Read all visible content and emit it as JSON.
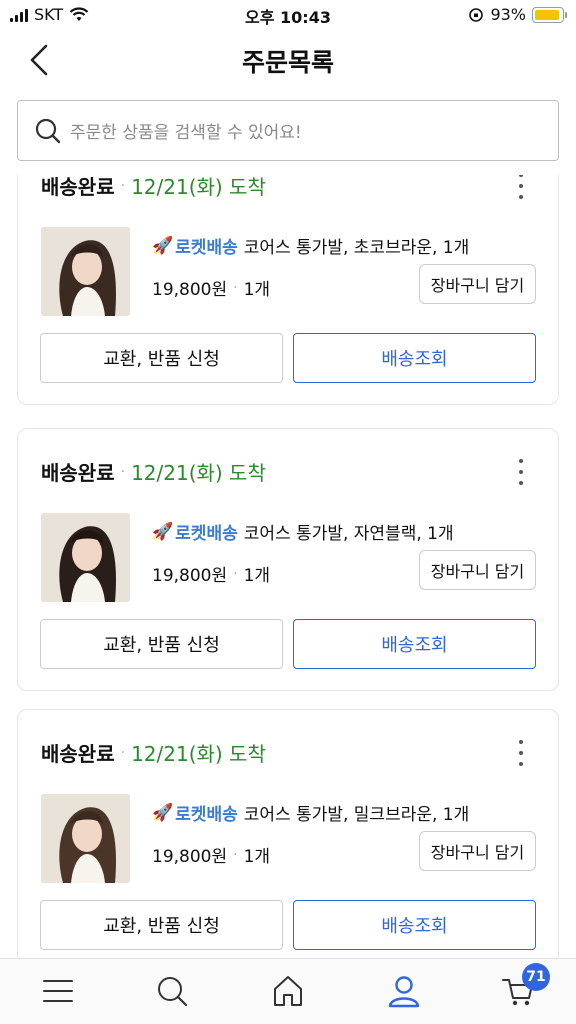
{
  "status_bar": {
    "carrier": "SKT",
    "time": "오후 10:43",
    "battery": "93%",
    "battery_level": 0.93,
    "battery_color": "#f5c400"
  },
  "header": {
    "title": "주문목록",
    "back_icon": "chevron-left-icon"
  },
  "search": {
    "placeholder": "주문한 상품을 검색할 수 있어요!",
    "icon": "search-icon"
  },
  "orders": [
    {
      "status": "배송완료",
      "arrival": "12/21(화) 도착",
      "rocket_label": "로켓배송",
      "product": "코어스 통가발, 초코브라운, 1개",
      "price": "19,800원",
      "quantity": "1개",
      "cart_button": "장바구니 담기",
      "exchange_button": "교환, 반품 신청",
      "track_button": "배송조회"
    },
    {
      "status": "배송완료",
      "arrival": "12/21(화) 도착",
      "rocket_label": "로켓배송",
      "product": "코어스 통가발, 자연블랙, 1개",
      "price": "19,800원",
      "quantity": "1개",
      "cart_button": "장바구니 담기",
      "exchange_button": "교환, 반품 신청",
      "track_button": "배송조회"
    },
    {
      "status": "배송완료",
      "arrival": "12/21(화) 도착",
      "rocket_label": "로켓배송",
      "product": "코어스 통가발, 밀크브라운, 1개",
      "price": "19,800원",
      "quantity": "1개",
      "cart_button": "장바구니 담기",
      "exchange_button": "교환, 반품 신청",
      "track_button": "배송조회"
    }
  ],
  "bottom_nav": {
    "items": [
      "menu-icon",
      "search-icon",
      "home-icon",
      "user-icon",
      "cart-icon"
    ],
    "active": "user-icon",
    "cart_badge": "71",
    "accent_color": "#2f66e0"
  },
  "colors": {
    "arrival": "#2b8a2b",
    "rocket": "#3a7bd5",
    "primary": "#2f66e0"
  }
}
